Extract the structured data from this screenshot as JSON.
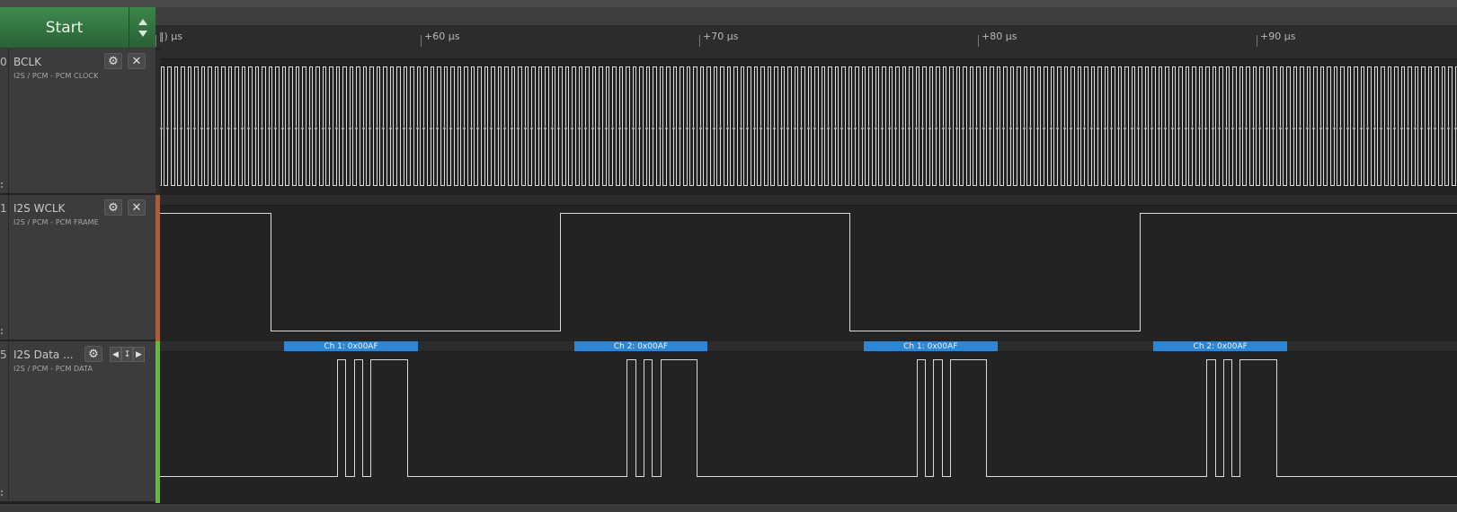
{
  "toolbar": {
    "start_label": "Start"
  },
  "time_axis": {
    "unit": "µs",
    "ticks": [
      {
        "label": "‖) µs",
        "value_us": 50
      },
      {
        "label": "+60 µs",
        "value_us": 60
      },
      {
        "label": "+70 µs",
        "value_us": 70
      },
      {
        "label": "+80 µs",
        "value_us": 80
      },
      {
        "label": "+90 µs",
        "value_us": 90
      }
    ]
  },
  "channels": [
    {
      "number": "0",
      "name": "BCLK",
      "subtitle": "I2S / PCM - PCM CLOCK",
      "color": "#2a2a2a"
    },
    {
      "number": "1",
      "name": "I2S WCLK",
      "subtitle": "I2S / PCM - PCM FRAME",
      "color": "#b5592a"
    },
    {
      "number": "5",
      "name": "I2S Data ...",
      "subtitle": "I2S / PCM - PCM DATA",
      "color": "#5fbf2a"
    }
  ],
  "signals": {
    "bclk": {
      "description": "continuous clock",
      "period_us": 0.31
    },
    "wclk": {
      "transitions_us": [
        54.6,
        65.0,
        75.4,
        85.8
      ],
      "initial_level": "high"
    },
    "data": {
      "pulse_groups_us": [
        [
          [
            57.0,
            57.3
          ],
          [
            57.6,
            57.9
          ],
          [
            58.2,
            59.5
          ]
        ],
        [
          [
            67.4,
            67.7
          ],
          [
            68.0,
            68.3
          ],
          [
            68.6,
            69.9
          ]
        ],
        [
          [
            77.8,
            78.1
          ],
          [
            78.4,
            78.7
          ],
          [
            79.0,
            80.3
          ]
        ],
        [
          [
            88.2,
            88.5
          ],
          [
            88.8,
            89.1
          ],
          [
            89.4,
            90.7
          ]
        ]
      ]
    }
  },
  "annotations": [
    {
      "label": "Ch 1: 0x00AF",
      "start_us": 55.1,
      "end_us": 59.9
    },
    {
      "label": "Ch 2: 0x00AF",
      "start_us": 65.5,
      "end_us": 70.3
    },
    {
      "label": "Ch 1: 0x00AF",
      "start_us": 75.9,
      "end_us": 80.7
    },
    {
      "label": "Ch 2: 0x00AF",
      "start_us": 86.3,
      "end_us": 91.1
    }
  ]
}
